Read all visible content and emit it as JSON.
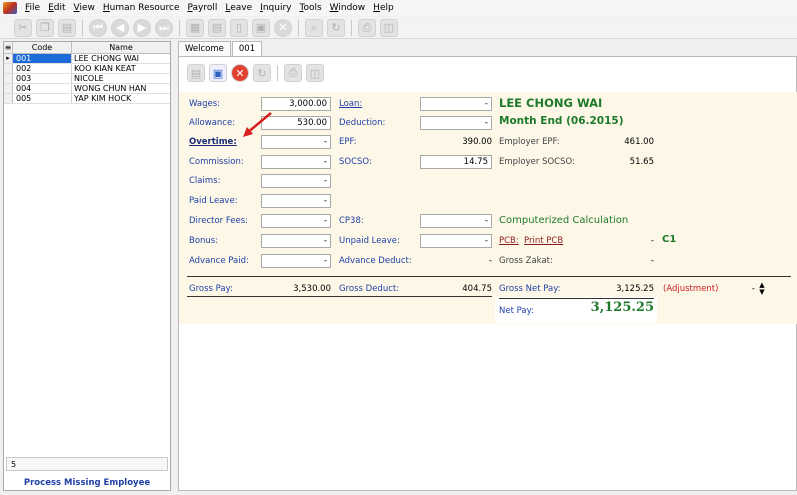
{
  "menu": [
    "File",
    "Edit",
    "View",
    "Human Resource",
    "Payroll",
    "Leave",
    "Inquiry",
    "Tools",
    "Window",
    "Help"
  ],
  "toolbar_icons": [
    "cut-icon",
    "copy-icon",
    "paste-icon",
    "first-record-icon",
    "previous-record-icon",
    "next-record-icon",
    "last-record-icon",
    "new-icon",
    "edit-icon",
    "blank-icon",
    "save-icon",
    "delete-icon",
    "find-icon",
    "refresh-icon",
    "print-icon",
    "preview-icon"
  ],
  "employee_list": {
    "headers": [
      "Code",
      "Name"
    ],
    "rows": [
      {
        "code": "001",
        "name": "LEE CHONG WAI"
      },
      {
        "code": "002",
        "name": "KOO KIAN KEAT"
      },
      {
        "code": "003",
        "name": "NICOLE"
      },
      {
        "code": "004",
        "name": "WONG CHUN HAN"
      },
      {
        "code": "005",
        "name": "YAP KIM HOCK"
      }
    ],
    "count": "5",
    "process_button": "Process Missing Employee"
  },
  "tabs": [
    "Welcome",
    "001"
  ],
  "employee": {
    "name": "LEE CHONG WAI",
    "period": "Month End (06.2015)"
  },
  "earnings": [
    {
      "label": "Wages:",
      "value": "3,000.00"
    },
    {
      "label": "Allowance:",
      "value": "530.00"
    },
    {
      "label": "Overtime:",
      "value": "-"
    },
    {
      "label": "Commission:",
      "value": "-"
    },
    {
      "label": "Claims:",
      "value": "-"
    },
    {
      "label": "Paid Leave:",
      "value": "-"
    },
    {
      "label": "Director Fees:",
      "value": "-"
    },
    {
      "label": "Bonus:",
      "value": "-"
    },
    {
      "label": "Advance Paid:",
      "value": "-"
    }
  ],
  "deductions": {
    "loan": {
      "label": "Loan:",
      "value": "-"
    },
    "deduction": {
      "label": "Deduction:",
      "value": "-"
    },
    "epf": {
      "label": "EPF:",
      "value": "390.00"
    },
    "socso": {
      "label": "SOCSO:",
      "value": "14.75"
    },
    "cp38": {
      "label": "CP38:",
      "value": "-"
    },
    "unpaid_leave": {
      "label": "Unpaid Leave:",
      "value": "-"
    },
    "advance_deduct": {
      "label": "Advance Deduct:",
      "value": "-"
    }
  },
  "employer": {
    "epf_label": "Employer EPF:",
    "epf_value": "461.00",
    "socso_label": "Employer SOCSO:",
    "socso_value": "51.65"
  },
  "computerized": "Computerized Calculation",
  "pcb": {
    "label": "PCB:",
    "link": "Print PCB",
    "value": "-",
    "code": "C1"
  },
  "zakat": {
    "label": "Gross Zakat:",
    "value": "-"
  },
  "totals": {
    "gross_pay_label": "Gross Pay:",
    "gross_pay": "3,530.00",
    "gross_deduct_label": "Gross Deduct:",
    "gross_deduct": "404.75",
    "gross_net_label": "Gross Net Pay:",
    "gross_net": "3,125.25",
    "adjustment_label": "(Adjustment)",
    "adjustment_value": "-",
    "net_pay_label": "Net Pay:",
    "net_pay": "3,125.25"
  },
  "colors": {
    "accent_blue": "#1f3fa6",
    "green": "#1d7a2a",
    "red": "#d02020",
    "form_bg": "#fdf7e8",
    "selection": "#1c6ad8"
  }
}
